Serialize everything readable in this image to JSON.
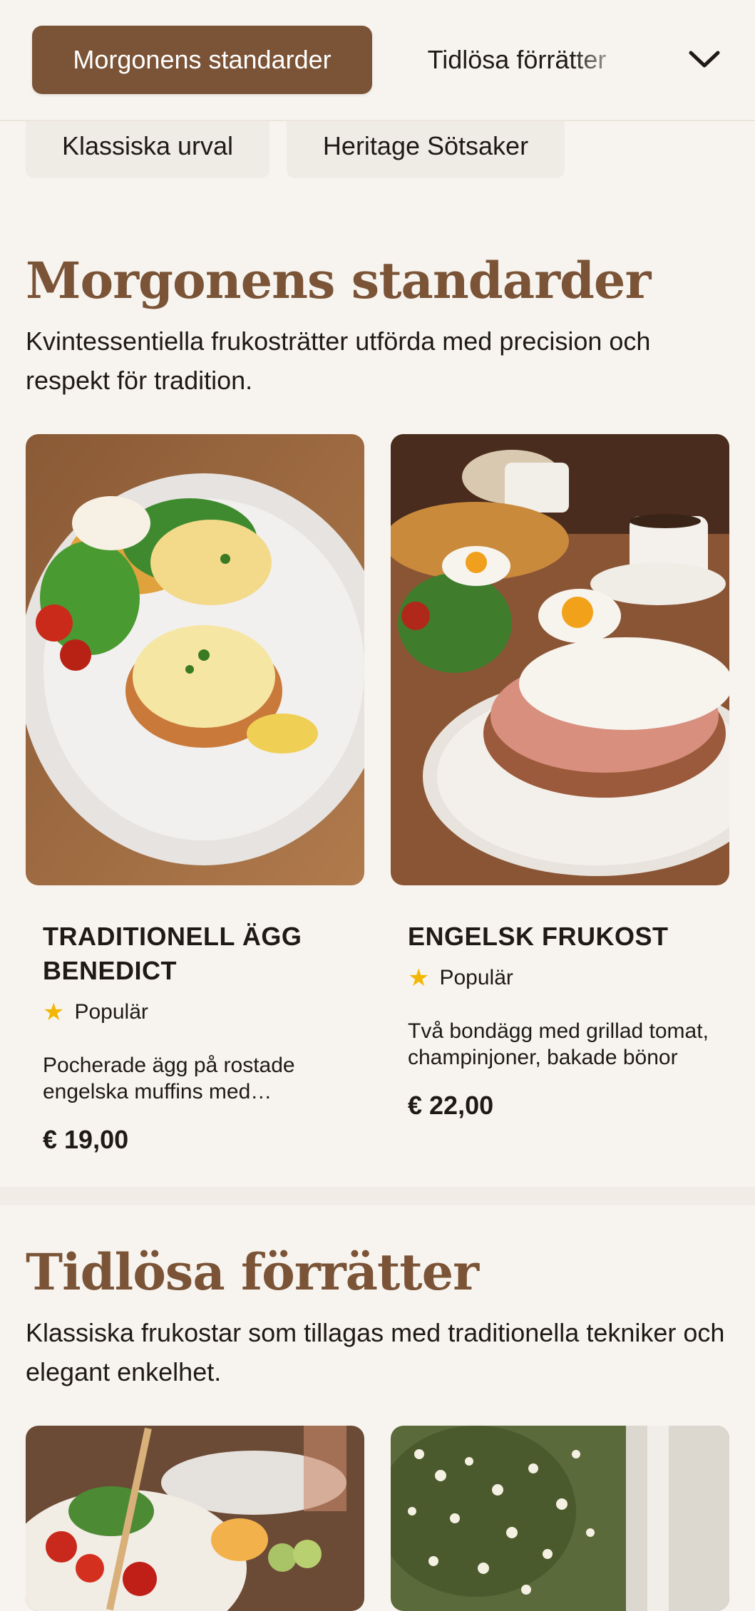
{
  "nav": {
    "active_tab": "Morgonens standarder",
    "second_tab": "Tidlösa förrätter",
    "expand_icon": "chevron-down-icon",
    "chips": [
      "Klassiska urval",
      "Heritage Sötsaker"
    ]
  },
  "sections": [
    {
      "title": "Morgonens standarder",
      "description": "Kvintessentiella frukosträtter utförda med precision och respekt för tradition.",
      "items": [
        {
          "name": "TRADITIONELL ÄGG BENEDICT",
          "badge": "Populär",
          "badge_icon": "star-icon",
          "description": "Pocherade ägg på rostade engelska muffins med hollandaisesås",
          "price": "€ 19,00"
        },
        {
          "name": "ENGELSK FRUKOST",
          "badge": "Populär",
          "badge_icon": "star-icon",
          "description": "Två bondägg med grillad tomat, champinjoner, bakade bönor",
          "price": "€ 22,00"
        }
      ]
    },
    {
      "title": "Tidlösa förrätter",
      "description": "Klassiska frukostar som tillagas med traditionella tekniker och elegant enkelhet."
    }
  ],
  "colors": {
    "accent": "#7b5437",
    "background": "#f7f4ef",
    "chip": "#efebe5",
    "star": "#f2b705"
  }
}
